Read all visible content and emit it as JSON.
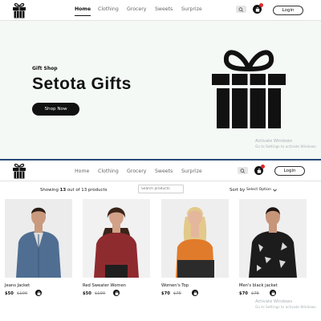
{
  "nav": {
    "items": [
      "Home",
      "Clothing",
      "Grocery",
      "Sweets",
      "Surprize"
    ],
    "active": "Home",
    "login_label": "Login",
    "cart_count": ""
  },
  "hero": {
    "kicker": "Gift Shop",
    "title": "Setota Gifts",
    "cta": "Shop Now"
  },
  "watermark": {
    "title": "Activate Windows",
    "subtitle": "Go to Settings to activate Windows."
  },
  "listing": {
    "showing_prefix": "Showing",
    "showing_count": "13",
    "showing_suffix": "out of 13 products",
    "search_placeholder": "Search products",
    "sort_label": "Sort by",
    "sort_value": "Select Option"
  },
  "products": [
    {
      "name": "Jeans Jacket",
      "price": "$50",
      "old_price": "$100",
      "image": "man-denim-jacket"
    },
    {
      "name": "Red Sweater Women",
      "price": "$50",
      "old_price": "$100",
      "image": "woman-red-sweater"
    },
    {
      "name": "Women's Top",
      "price": "$70",
      "old_price": "$75",
      "image": "woman-orange-top"
    },
    {
      "name": "Men's black jacket",
      "price": "$70",
      "old_price": "$75",
      "image": "man-black-jacket"
    }
  ],
  "colors": {
    "primary": "#111111",
    "hero_bg": "#f4f9f6",
    "badge": "#e0262b",
    "divider": "#2b4a7b"
  }
}
